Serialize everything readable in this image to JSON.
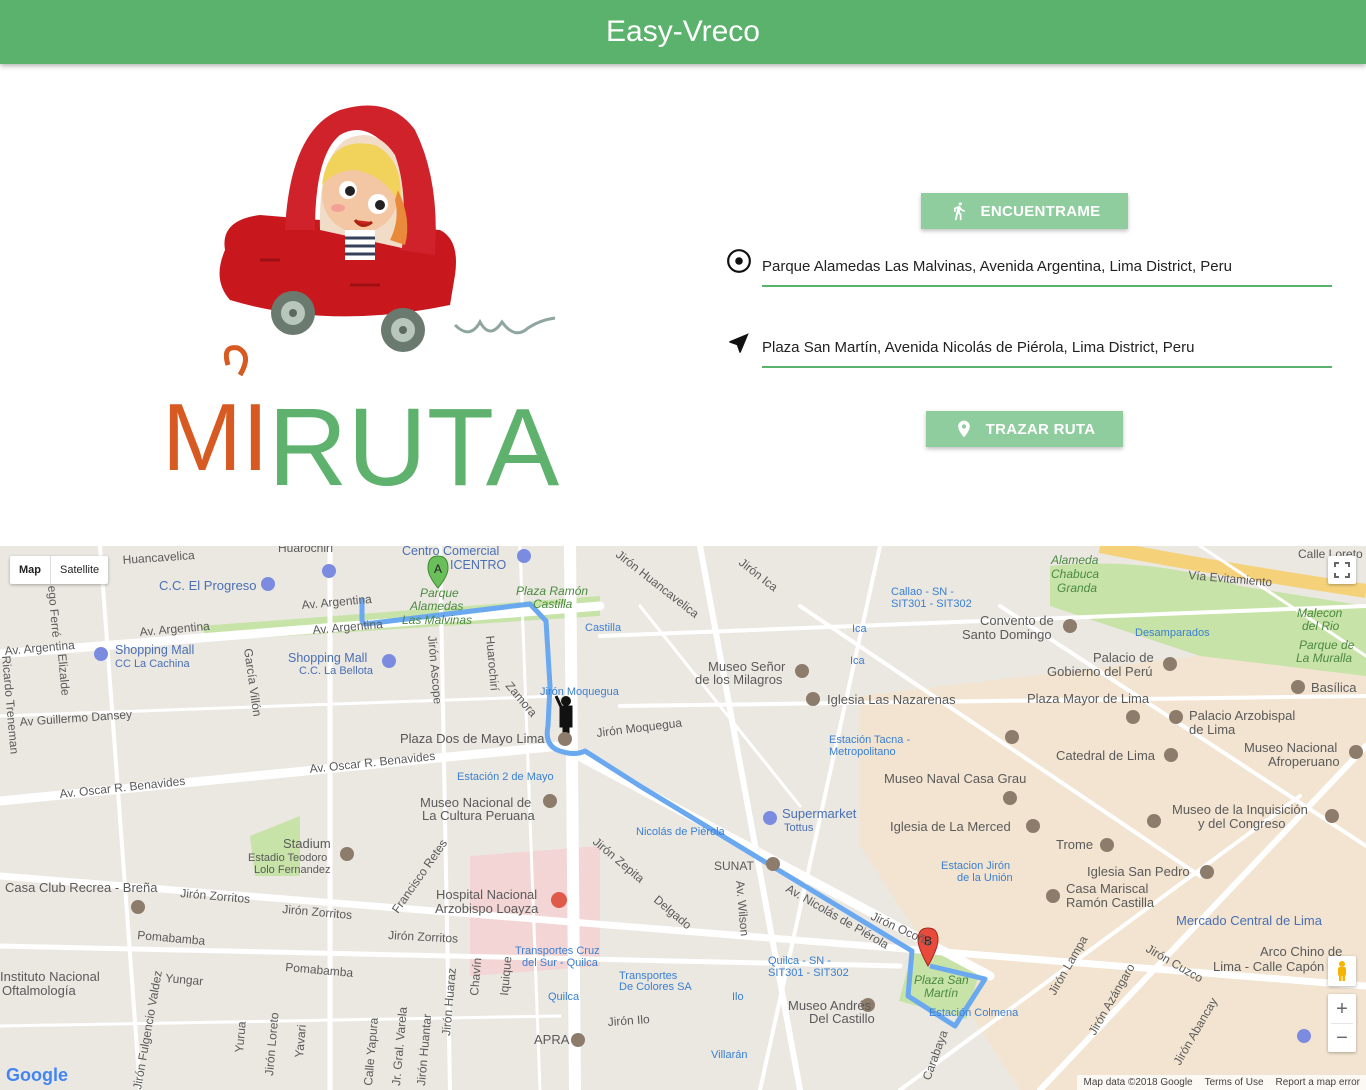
{
  "app": {
    "title": "Easy-Vreco"
  },
  "logo": {
    "text_mi": "MI",
    "text_ruta": "RUTA"
  },
  "actions": {
    "find_me_label": "ENCUENTRAME",
    "trace_route_label": "TRAZAR RUTA"
  },
  "origin": {
    "value": "Parque Alamedas Las Malvinas, Avenida Argentina, Lima District, Peru"
  },
  "destination": {
    "value": "Plaza San Martín, Avenida Nicolás de Piérola, Lima District, Peru"
  },
  "map": {
    "type_map": "Map",
    "type_satellite": "Satellite",
    "zoom_in": "+",
    "zoom_out": "−",
    "attribution": "Map data ©2018 Google",
    "terms": "Terms of Use",
    "report": "Report a map error",
    "google": "Google",
    "marker_a": "A",
    "marker_b": "B",
    "route_color": "#6aa9f0",
    "labels": {
      "huancavelica": "Huancavelica",
      "centro_comercial": "Centro Comercial",
      "icentro": "ICENTRO",
      "cc_progreso": "C.C. El Progreso",
      "av_argentina_1": "Av. Argentina",
      "av_argentina_2": "Av. Argentina",
      "av_argentina_3": "Av. Argentina",
      "av_argentina_4": "Av. Argentina",
      "parque_alamedas": "Parque",
      "parque_alamedas2": "Alamedas",
      "parque_alamedas3": "Las Malvinas",
      "plaza_ramon": "Plaza Ramón",
      "plaza_ramon2": "Castilla",
      "castilla": "Castilla",
      "shopping1": "Shopping Mall",
      "shopping1b": "CC La Cachina",
      "shopping2": "Shopping Mall",
      "shopping2b": "C.C. La Bellota",
      "jr_moquegua": "Jirón Moquegua",
      "jr_moquegua2": "Jirón Moquegua",
      "plaza_dos_mayo": "Plaza Dos de Mayo Lima",
      "av_oscar": "Av. Oscar R. Benavides",
      "av_oscar2": "Av. Oscar R. Benavides",
      "estacion_2mayo": "Estación 2 de Mayo",
      "museo_cultura": "Museo Nacional de",
      "museo_cultura2": "La Cultura Peruana",
      "stadium": "Stadium",
      "stadium2": "Estadio Teodoro",
      "stadium3": "Lolo Fernandez",
      "casa_club": "Casa Club Recrea - Breña",
      "jr_zorritos": "Jirón Zorritos",
      "jr_zorritos2": "Jirón Zorritos",
      "jr_zorritos3": "Jirón Zorritos",
      "hospital": "Hospital Nacional",
      "hospital2": "Arzobispo Loayza",
      "transportes_cruz": "Transportes Cruz",
      "transportes_cruz2": "del Sur - Quilca",
      "transportes_colores": "Transportes",
      "transportes_colores2": "De Colores SA",
      "quilca": "Quilca",
      "apra": "APRA",
      "pomabamba": "Pomabamba",
      "pomabamba2": "Pomabamba",
      "yungar": "Yungar",
      "instituto": "Instituto Nacional",
      "instituto2": "Oftalmología",
      "jr_ilo": "Jirón Ilo",
      "villaran": "Villarán",
      "ilo": "Ilo",
      "quilca_sn": "Quilca - SN -",
      "quilca_sn2": "SIT301 - SIT302",
      "plaza_san_martin": "Plaza San",
      "plaza_san_martin2": "Martín",
      "estacion_colmena": "Estación Colmena",
      "museo_andres": "Museo Andrés",
      "museo_andres2": "Del Castillo",
      "av_nicolas": "Av. Nicolás de Piérola",
      "nicolas_pierola": "Nicolás de Piérola",
      "sunat": "SUNAT",
      "av_wilson": "Av. Wilson",
      "supermarket": "Supermarket",
      "supermarket2": "Tottus",
      "iglesia_merced": "Iglesia de La Merced",
      "museo_naval": "Museo Naval Casa Grau",
      "estacion_tacna": "Estación Tacna -",
      "estacion_tacna2": "Metropolitano",
      "iglesia_nazarenas": "Iglesia Las Nazarenas",
      "museo_milagros": "Museo Señor",
      "museo_milagros2": "de los Milagros",
      "ica": "Ica",
      "ica2": "Ica",
      "callao": "Callao - SN -",
      "callao2": "SIT301 - SIT302",
      "jr_huancavelica": "Jirón Huancavelica",
      "jr_ica": "Jirón Ica",
      "alameda_chabuca": "Alameda",
      "alameda_chabuca2": "Chabuca",
      "alameda_chabuca3": "Granda",
      "via_evitamiento": "Vía Evitamiento",
      "calle_loreto": "Calle Loreto",
      "convento": "Convento de",
      "convento2": "Santo Domingo",
      "desamparados": "Desamparados",
      "malecon": "Malecon",
      "malecon2": "del Rio",
      "parque_muralla": "Parque de",
      "parque_muralla2": "La Muralla",
      "palacio_gobierno": "Palacio de",
      "palacio_gobierno2": "Gobierno del Perú",
      "basilica": "Basílica",
      "plaza_mayor": "Plaza Mayor de Lima",
      "palacio_arzobispal": "Palacio Arzobispal",
      "palacio_arzobispal2": "de Lima",
      "catedral": "Catedral de Lima",
      "museo_afro": "Museo Nacional",
      "museo_afro2": "Afroperuano",
      "museo_inquisicion": "Museo de la Inquisición",
      "museo_inquisicion2": "y del Congreso",
      "trome": "Trome",
      "estacion_union": "Estacion Jirón",
      "estacion_union2": "de la Unión",
      "iglesia_san_pedro": "Iglesia San Pedro",
      "casa_mariscal": "Casa Mariscal",
      "casa_mariscal2": "Ramón Castilla",
      "mercado_central": "Mercado Central de Lima",
      "arco_chino": "Arco Chino de",
      "arco_chino2": "Lima - Calle Capón",
      "jr_cuzco": "Jirón Cuzco",
      "jr_azangaro": "Jirón Azángaro",
      "jr_lampa": "Jirón Lampa",
      "jr_abancay": "Jirón Abancay",
      "jr_ocona": "Jirón Ocoña",
      "carabaya": "Carabaya",
      "jr_zepita": "Jirón Zepita",
      "delgado": "Delgado",
      "francisco_retes": "Francisco Retes",
      "zamora": "Zamora",
      "huarochiri": "Huarochirí",
      "jr_ascope": "Jirón Ascope",
      "garcia_villon": "García Villón",
      "elizalde": "Elizalde",
      "ego_ferre": "ego Ferré",
      "ricardo_treneman": "Ricardo Treneman",
      "av_guillermo": "Av Guillermo Dansey",
      "huarochiri_top": "Huarochirí",
      "jr_fulgencio": "Jirón Fulgencio Valdez",
      "jr_loreto": "Jirón Loreto",
      "yavari": "Yavari",
      "yurua": "Yurua",
      "calle_yapura": "Calle Yapura",
      "jr_gral_varela": "Jr. Gral. Varela",
      "jr_huantar": "Jirón Huantar",
      "jr_huaraz": "Jirón Huaraz",
      "chavin": "Chavín",
      "iquique": "Iquique"
    }
  }
}
